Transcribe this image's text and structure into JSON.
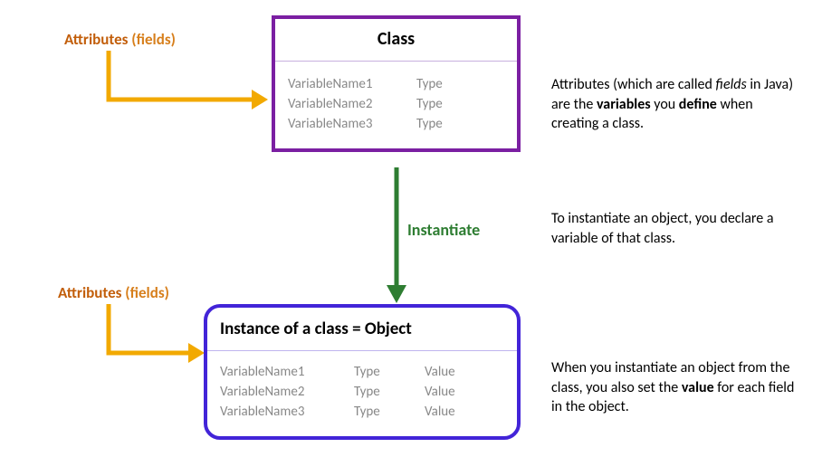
{
  "labels": {
    "attributes_word": "Attributes",
    "fields_paren": "(fields)"
  },
  "class_box": {
    "title": "Class",
    "rows": [
      {
        "name": "VariableName1",
        "type": "Type"
      },
      {
        "name": "VariableName2",
        "type": "Type"
      },
      {
        "name": "VariableName3",
        "type": "Type"
      }
    ]
  },
  "arrow": {
    "instantiate": "Instantiate"
  },
  "obj_box": {
    "title_instanceof": "Instance of a class",
    "title_eq": " = ",
    "title_object": "Object",
    "rows": [
      {
        "name": "VariableName1",
        "type": "Type",
        "value": "Value"
      },
      {
        "name": "VariableName2",
        "type": "Type",
        "value": "Value"
      },
      {
        "name": "VariableName3",
        "type": "Type",
        "value": "Value"
      }
    ]
  },
  "paras": {
    "p1_a": "Attributes (which are called ",
    "p1_b_italic": "fields",
    "p1_c": " in Java) are the ",
    "p1_d_bold": "variables",
    "p1_e": " you ",
    "p1_f_bold": "define",
    "p1_g": " when creating a class.",
    "p2": "To instantiate an object, you declare a variable of that class.",
    "p3_a": "When you instantiate an object from the class, you also set the ",
    "p3_b_bold": "value",
    "p3_c": " for each field in the object."
  }
}
